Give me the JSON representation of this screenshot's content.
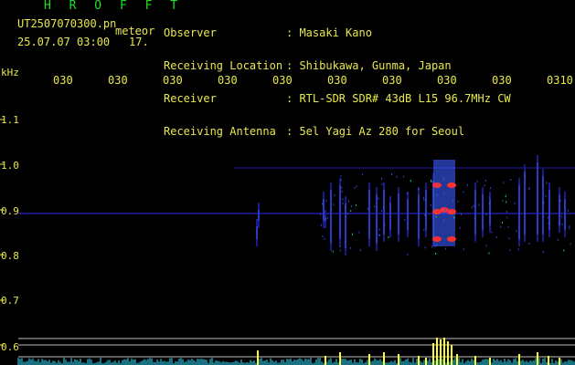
{
  "header": {
    "title": "H R O F F T",
    "file_name": "UT2507070300.pn",
    "meteor_label": "meteor",
    "datetime": "25.07.07 03:00",
    "count": "17.",
    "fields": [
      {
        "label": "Observer",
        "value": ": Masaki Kano"
      },
      {
        "label": "Receiving Location",
        "value": ": Shibukawa, Gunma, Japan"
      },
      {
        "label": "Receiver",
        "value": ": RTL-SDR SDR# 43dB L15 96.7MHz CW"
      },
      {
        "label": "Receiving Antenna",
        "value": ": 5el Yagi Az 280 for Seoul"
      }
    ]
  },
  "axis": {
    "unit": "kHz",
    "time_ticks": [
      "030",
      "030",
      "030",
      "030",
      "030",
      "030",
      "030",
      "030",
      "030",
      "0310"
    ],
    "freq_ticks": [
      "1.1",
      "1.0",
      "0.9",
      "0.8",
      "0.7",
      "0.6"
    ]
  },
  "colors": {
    "text_yellow": "#e8e84a",
    "title_green": "#22dd22",
    "background": "#000000",
    "signal_dark": "#1a1a8a",
    "signal_mid": "#3b5bff",
    "signal_hot": "#ff3030",
    "count_bars": "#ffff30",
    "noise_floor": "#30e0ff"
  }
}
